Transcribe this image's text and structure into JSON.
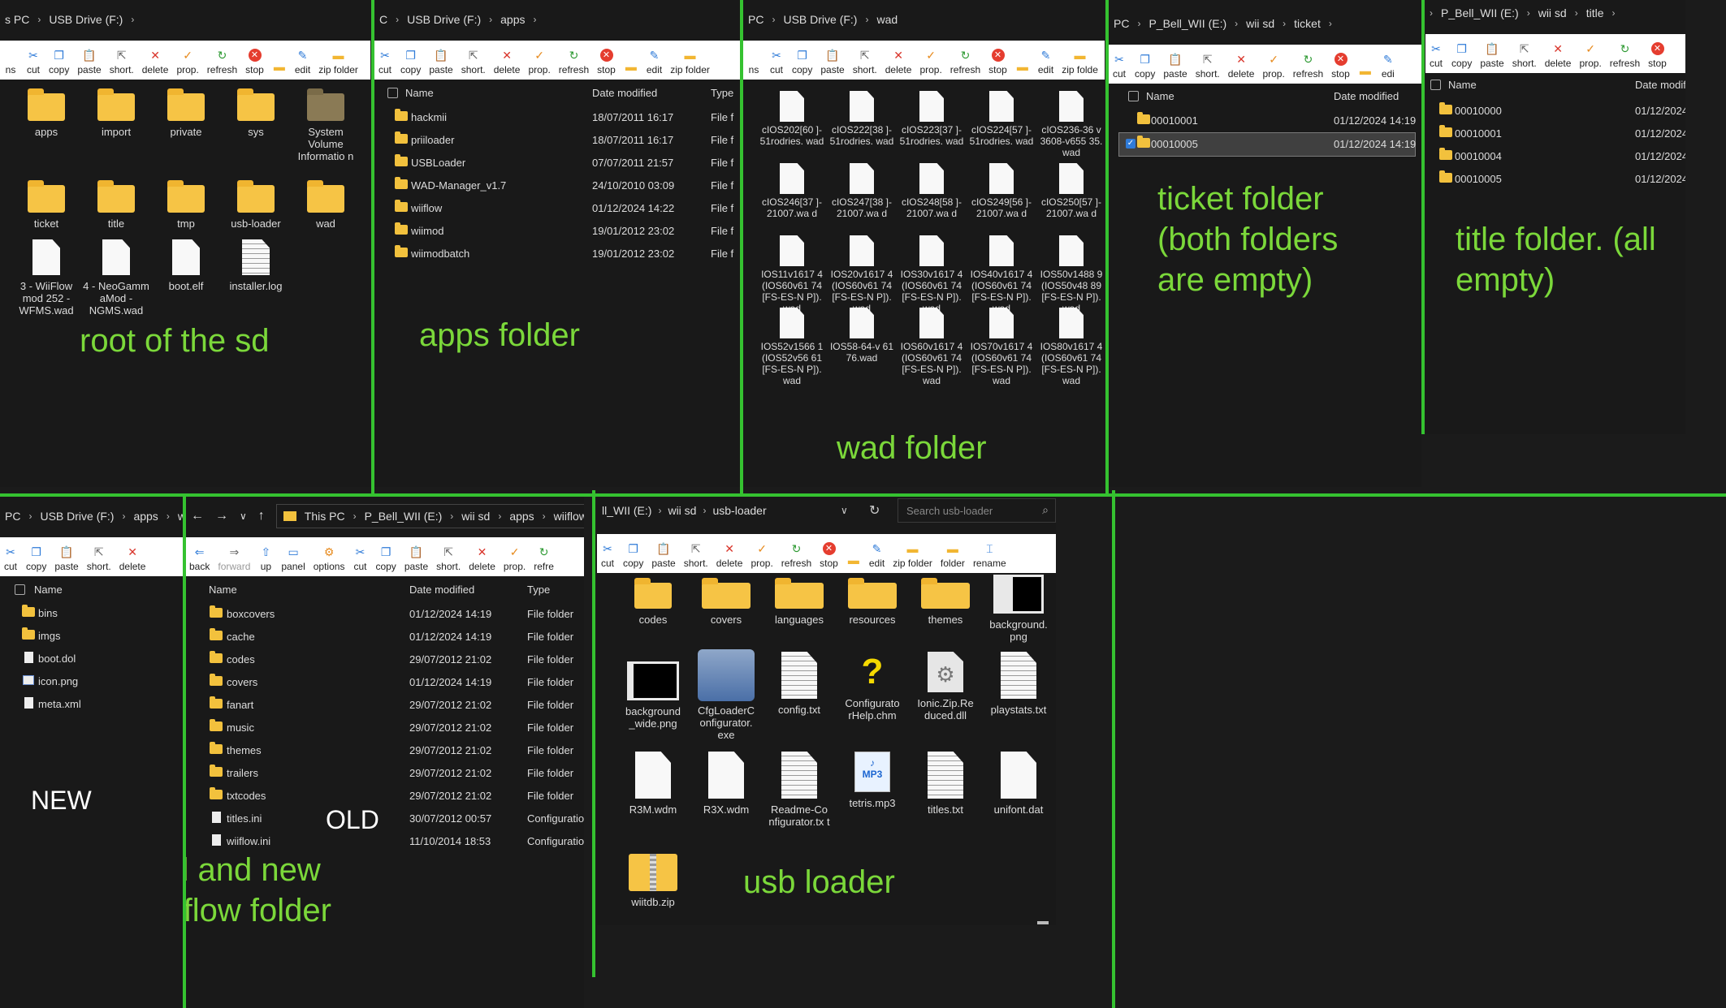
{
  "captions": {
    "root": "root of the sd",
    "apps": "apps folder",
    "wad": "wad folder",
    "ticket": "ticket folder\n(both folders\nare empty)",
    "title": "title folder. (all\nempty)",
    "wiiflow": "old and new\nwiiflow folder",
    "usb": "usb loader",
    "new": "NEW",
    "old": "OLD"
  },
  "toolbar": {
    "ns": "ns",
    "cut": "cut",
    "copy": "copy",
    "paste": "paste",
    "short": "short.",
    "delete": "delete",
    "prop": "prop.",
    "refresh": "refresh",
    "stop": "stop",
    "edit": "edit",
    "zip": "zip folder",
    "zip_trunc": "zip folde",
    "edi": "edi",
    "back": "back",
    "forward": "forward",
    "up": "up",
    "panel": "panel",
    "options": "options",
    "refr": "refre",
    "pr": "pr",
    "folder": "folder",
    "rename": "rename"
  },
  "columns": {
    "name": "Name",
    "date": "Date modified",
    "type": "Type",
    "date_trunc": "Date modif"
  },
  "root_panel": {
    "crumb": [
      "s PC",
      "USB Drive (F:)"
    ],
    "row1": [
      "apps",
      "import",
      "private",
      "sys",
      "System Volume Informatio n"
    ],
    "row2": [
      "ticket",
      "title",
      "tmp",
      "usb-loader",
      "wad"
    ],
    "row3": [
      "3 - WiiFlow mod 252 - WFMS.wad",
      "4 - NeoGamm aMod - NGMS.wad",
      "boot.elf",
      "installer.log"
    ]
  },
  "apps_panel": {
    "crumb": [
      "C",
      "USB Drive (F:)",
      "apps"
    ],
    "rows": [
      {
        "name": "hackmii",
        "date": "18/07/2011 16:17",
        "type": "File f"
      },
      {
        "name": "priiloader",
        "date": "18/07/2011 16:17",
        "type": "File f"
      },
      {
        "name": "USBLoader",
        "date": "07/07/2011 21:57",
        "type": "File f"
      },
      {
        "name": "WAD-Manager_v1.7",
        "date": "24/10/2010 03:09",
        "type": "File f"
      },
      {
        "name": "wiiflow",
        "date": "01/12/2024 14:22",
        "type": "File f"
      },
      {
        "name": "wiimod",
        "date": "19/01/2012 23:02",
        "type": "File f"
      },
      {
        "name": "wiimodbatch",
        "date": "19/01/2012 23:02",
        "type": "File f"
      }
    ]
  },
  "wad_panel": {
    "crumb": [
      "PC",
      "USB Drive (F:)",
      "wad"
    ],
    "files": [
      "cIOS202[60 ]-51rodries. wad",
      "cIOS222[38 ]-51rodries. wad",
      "cIOS223[37 ]-51rodries. wad",
      "cIOS224[57 ]-51rodries. wad",
      "cIOS236-36 v3608-v655 35.wad",
      "cIOS246[37 ]-21007.wa d",
      "cIOS247[38 ]-21007.wa d",
      "cIOS248[58 ]-21007.wa d",
      "cIOS249[56 ]-21007.wa d",
      "cIOS250[57 ]-21007.wa d",
      "IOS11v1617 4(IOS60v61 74[FS-ES-N P]).wad",
      "IOS20v1617 4(IOS60v61 74[FS-ES-N P]).wad",
      "IOS30v1617 4(IOS60v61 74[FS-ES-N P]).wad",
      "IOS40v1617 4(IOS60v61 74[FS-ES-N P]).wad",
      "IOS50v1488 9(IOS50v48 89[FS-ES-N P]).wad",
      "IOS52v1566 1(IOS52v56 61[FS-ES-N P]).wad",
      "IOS58-64-v 6176.wad",
      "IOS60v1617 4(IOS60v61 74[FS-ES-N P]).wad",
      "IOS70v1617 4(IOS60v61 74[FS-ES-N P]).wad",
      "IOS80v1617 4(IOS60v61 74[FS-ES-N P]).wad"
    ]
  },
  "ticket_panel": {
    "crumb": [
      "PC",
      "P_Bell_WII (E:)",
      "wii sd",
      "ticket"
    ],
    "rows": [
      {
        "name": "00010001",
        "date": "01/12/2024 14:19"
      },
      {
        "name": "00010005",
        "date": "01/12/2024 14:19"
      }
    ]
  },
  "title_panel": {
    "crumb": [
      "P_Bell_WII (E:)",
      "wii sd",
      "title"
    ],
    "rows": [
      {
        "name": "00010000",
        "date": "01/12/2024"
      },
      {
        "name": "00010001",
        "date": "01/12/2024"
      },
      {
        "name": "00010004",
        "date": "01/12/2024"
      },
      {
        "name": "00010005",
        "date": "01/12/2024"
      }
    ]
  },
  "new_panel": {
    "crumb": [
      "PC",
      "USB Drive (F:)",
      "apps",
      "wiiflow"
    ],
    "rows": [
      "bins",
      "imgs",
      "boot.dol",
      "icon.png",
      "meta.xml"
    ]
  },
  "old_panel": {
    "crumb": [
      "This PC",
      "P_Bell_WII (E:)",
      "wii sd",
      "apps",
      "wiiflow"
    ],
    "rows": [
      {
        "name": "boxcovers",
        "date": "01/12/2024 14:19",
        "type": "File folder"
      },
      {
        "name": "cache",
        "date": "01/12/2024 14:19",
        "type": "File folder"
      },
      {
        "name": "codes",
        "date": "29/07/2012 21:02",
        "type": "File folder"
      },
      {
        "name": "covers",
        "date": "01/12/2024 14:19",
        "type": "File folder"
      },
      {
        "name": "fanart",
        "date": "29/07/2012 21:02",
        "type": "File folder"
      },
      {
        "name": "music",
        "date": "29/07/2012 21:02",
        "type": "File folder"
      },
      {
        "name": "themes",
        "date": "29/07/2012 21:02",
        "type": "File folder"
      },
      {
        "name": "trailers",
        "date": "29/07/2012 21:02",
        "type": "File folder"
      },
      {
        "name": "txtcodes",
        "date": "29/07/2012 21:02",
        "type": "File folder"
      },
      {
        "name": "titles.ini",
        "date": "30/07/2012 00:57",
        "type": "Configuration"
      },
      {
        "name": "wiiflow.ini",
        "date": "11/10/2014 18:53",
        "type": "Configuration"
      }
    ]
  },
  "usb_panel": {
    "crumb": [
      "ll_WII (E:)",
      "wii sd",
      "usb-loader"
    ],
    "search_placeholder": "Search usb-loader",
    "row1": [
      "codes",
      "covers",
      "languages",
      "resources",
      "themes",
      "background. png"
    ],
    "row2": [
      "background _wide.png",
      "CfgLoaderC onfigurator. exe",
      "config.txt",
      "Configurato rHelp.chm",
      "Ionic.Zip.Re duced.dll",
      "playstats.txt"
    ],
    "row3": [
      "R3M.wdm",
      "R3X.wdm",
      "Readme-Co nfigurator.tx t",
      "tetris.mp3",
      "titles.txt",
      "unifont.dat"
    ],
    "row4": [
      "wiitdb.zip"
    ],
    "mp3_label": "MP3"
  },
  "accent_color": "#35c230",
  "caption_color": "#7bd83a"
}
